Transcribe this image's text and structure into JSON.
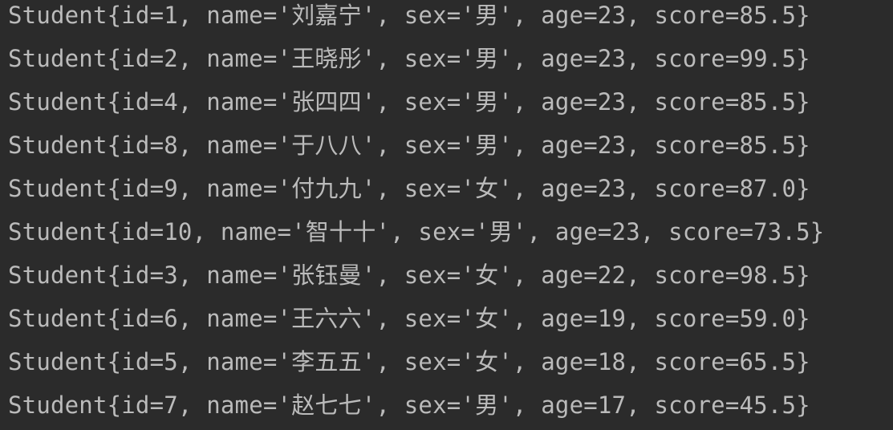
{
  "console": {
    "lines": [
      "Student{id=1, name='刘嘉宁', sex='男', age=23, score=85.5}",
      "Student{id=2, name='王晓彤', sex='男', age=23, score=99.5}",
      "Student{id=4, name='张四四', sex='男', age=23, score=85.5}",
      "Student{id=8, name='于八八', sex='男', age=23, score=85.5}",
      "Student{id=9, name='付九九', sex='女', age=23, score=87.0}",
      "Student{id=10, name='智十十', sex='男', age=23, score=73.5}",
      "Student{id=3, name='张钰曼', sex='女', age=22, score=98.5}",
      "Student{id=6, name='王六六', sex='女', age=19, score=59.0}",
      "Student{id=5, name='李五五', sex='女', age=18, score=65.5}",
      "Student{id=7, name='赵七七', sex='男', age=17, score=45.5}"
    ]
  },
  "colors": {
    "background": "#2b2b2b",
    "text": "#bbbbbb"
  }
}
